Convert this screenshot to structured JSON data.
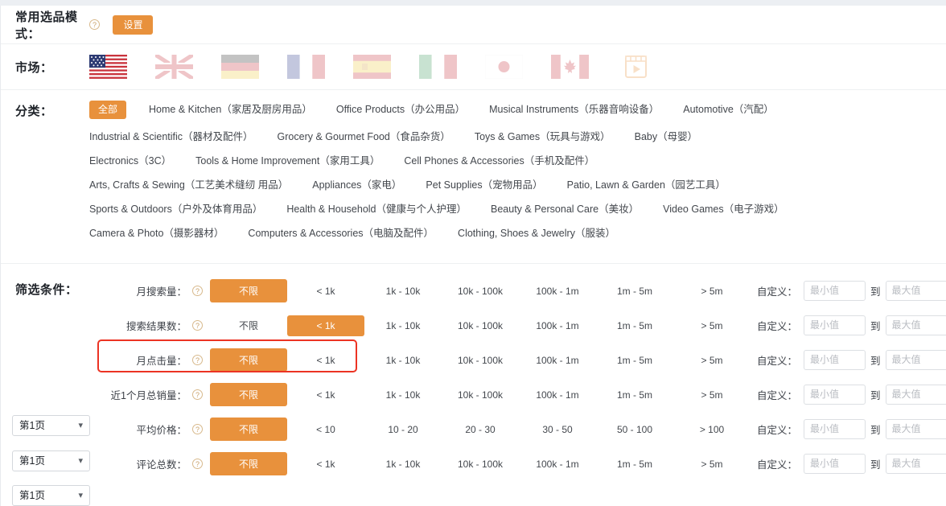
{
  "mode": {
    "label": "常用选品模式：",
    "help_icon": "question-circle-icon",
    "settings_label": "设置"
  },
  "market": {
    "label": "市场：",
    "items": [
      {
        "name": "us-flag",
        "code": "US",
        "selected": true
      },
      {
        "name": "uk-flag",
        "code": "UK",
        "selected": false
      },
      {
        "name": "de-flag",
        "code": "DE",
        "selected": false
      },
      {
        "name": "fr-flag",
        "code": "FR",
        "selected": false
      },
      {
        "name": "es-flag",
        "code": "ES",
        "selected": false
      },
      {
        "name": "it-flag",
        "code": "IT",
        "selected": false
      },
      {
        "name": "jp-flag",
        "code": "JP",
        "selected": false
      },
      {
        "name": "ca-flag",
        "code": "CA",
        "selected": false
      },
      {
        "name": "video-icon",
        "code": "VIDEO",
        "selected": false
      }
    ]
  },
  "category": {
    "label": "分类：",
    "items": [
      {
        "label": "全部",
        "selected": true
      },
      {
        "label": "Home & Kitchen（家居及厨房用品）",
        "selected": false
      },
      {
        "label": "Office Products（办公用品）",
        "selected": false
      },
      {
        "label": "Musical Instruments（乐器音响设备）",
        "selected": false
      },
      {
        "label": "Automotive（汽配）",
        "selected": false
      },
      {
        "label": "Industrial & Scientific（器材及配件）",
        "selected": false
      },
      {
        "label": "Grocery & Gourmet Food（食品杂货）",
        "selected": false
      },
      {
        "label": "Toys & Games（玩具与游戏）",
        "selected": false
      },
      {
        "label": "Baby（母婴）",
        "selected": false
      },
      {
        "label": "Electronics（3C）",
        "selected": false
      },
      {
        "label": "Tools & Home Improvement（家用工具）",
        "selected": false
      },
      {
        "label": "Cell Phones & Accessories（手机及配件）",
        "selected": false
      },
      {
        "label": "Arts, Crafts & Sewing（工艺美术缝纫 用品）",
        "selected": false
      },
      {
        "label": "Appliances（家电）",
        "selected": false
      },
      {
        "label": "Pet Supplies（宠物用品）",
        "selected": false
      },
      {
        "label": "Patio, Lawn & Garden（园艺工具）",
        "selected": false
      },
      {
        "label": "Sports & Outdoors（户外及体育用品）",
        "selected": false
      },
      {
        "label": "Health & Household（健康与个人护理）",
        "selected": false
      },
      {
        "label": "Beauty & Personal Care（美妆）",
        "selected": false
      },
      {
        "label": "Video Games（电子游戏）",
        "selected": false
      },
      {
        "label": "Camera & Photo（摄影器材）",
        "selected": false
      },
      {
        "label": "Computers & Accessories（电脑及配件）",
        "selected": false
      },
      {
        "label": "Clothing, Shoes & Jewelry（服装）",
        "selected": false
      }
    ]
  },
  "filters": {
    "label": "筛选条件：",
    "custom_label": "自定义：",
    "to_label": "到",
    "min_placeholder": "最小值",
    "max_placeholder": "最大值",
    "help_icon": "question-circle-icon",
    "highlight_color": "#ec3323",
    "accent_color": "#e8913c",
    "rows": [
      {
        "name": "月搜索量：",
        "options": [
          "不限",
          "< 1k",
          "1k - 10k",
          "10k - 100k",
          "100k - 1m",
          "1m - 5m",
          "> 5m"
        ],
        "selected_index": 0,
        "highlighted": false
      },
      {
        "name": "搜索结果数：",
        "options": [
          "不限",
          "< 1k",
          "1k - 10k",
          "10k - 100k",
          "100k - 1m",
          "1m - 5m",
          "> 5m"
        ],
        "selected_index": 1,
        "highlighted": true
      },
      {
        "name": "月点击量：",
        "options": [
          "不限",
          "< 1k",
          "1k - 10k",
          "10k - 100k",
          "100k - 1m",
          "1m - 5m",
          "> 5m"
        ],
        "selected_index": 0,
        "highlighted": false
      },
      {
        "name": "近1个月总销量：",
        "options": [
          "不限",
          "< 1k",
          "1k - 10k",
          "10k - 100k",
          "100k - 1m",
          "1m - 5m",
          "> 5m"
        ],
        "selected_index": 0,
        "highlighted": false
      },
      {
        "name": "平均价格：",
        "options": [
          "不限",
          "< 10",
          "10 - 20",
          "20 - 30",
          "30 - 50",
          "50 - 100",
          "> 100"
        ],
        "selected_index": 0,
        "highlighted": false
      },
      {
        "name": "评论总数：",
        "options": [
          "不限",
          "< 1k",
          "1k - 10k",
          "10k - 100k",
          "100k - 1m",
          "1m - 5m",
          "> 5m"
        ],
        "selected_index": 0,
        "highlighted": false
      }
    ]
  },
  "page_selects": [
    {
      "value": "第1页",
      "chevron": "chevron-down-icon"
    },
    {
      "value": "第1页",
      "chevron": "chevron-down-icon"
    },
    {
      "value": "第1页",
      "chevron": "chevron-down-icon"
    }
  ]
}
